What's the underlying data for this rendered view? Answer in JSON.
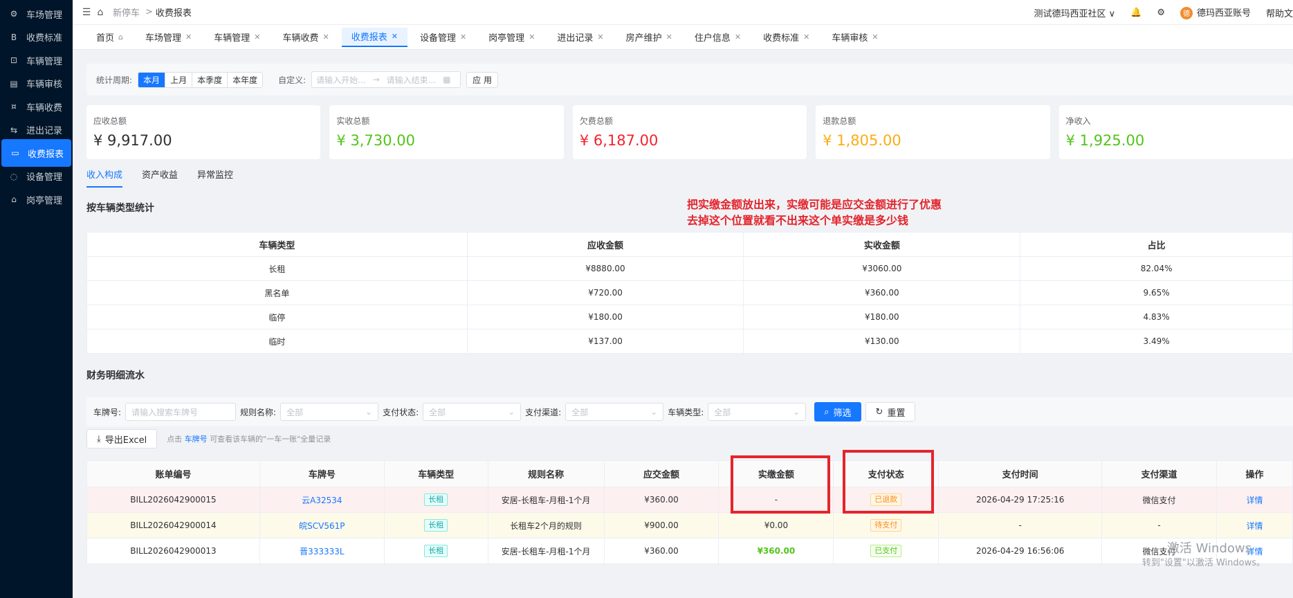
{
  "sidebar": {
    "items": [
      {
        "label": "车场管理",
        "icon": "gear-icon"
      },
      {
        "label": "收费标准",
        "icon": "b-icon"
      },
      {
        "label": "车辆管理",
        "icon": "car-icon"
      },
      {
        "label": "车辆审核",
        "icon": "audit-icon"
      },
      {
        "label": "车辆收费",
        "icon": "coin-icon"
      },
      {
        "label": "进出记录",
        "icon": "record-icon"
      },
      {
        "label": "收费报表",
        "icon": "report-icon"
      },
      {
        "label": "设备管理",
        "icon": "device-icon"
      },
      {
        "label": "岗亭管理",
        "icon": "booth-icon"
      }
    ]
  },
  "header": {
    "breadcrumb": [
      "新停车",
      "收费报表"
    ],
    "community": "测试德玛西亚社区",
    "account": "德玛西亚账号",
    "avatar_char": "德",
    "help": "帮助文"
  },
  "tabs": [
    "首页",
    "车场管理",
    "车辆管理",
    "车辆收费",
    "收费报表",
    "设备管理",
    "岗亭管理",
    "进出记录",
    "房产维护",
    "住户信息",
    "收费标准",
    "车辆审核"
  ],
  "period": {
    "label": "统计周期:",
    "options": [
      "本月",
      "上月",
      "本季度",
      "本年度"
    ],
    "custom_label": "自定义:",
    "start_placeholder": "请输入开始...",
    "end_placeholder": "请输入结束...",
    "apply": "应 用"
  },
  "cards": [
    {
      "title": "应收总额",
      "value": "¥ 9,917.00",
      "color": "#303133"
    },
    {
      "title": "实收总额",
      "value": "¥ 3,730.00",
      "color": "#52c41a"
    },
    {
      "title": "欠费总额",
      "value": "¥ 6,187.00",
      "color": "#f5222d"
    },
    {
      "title": "退款总额",
      "value": "¥ 1,805.00",
      "color": "#faad14"
    },
    {
      "title": "净收入",
      "value": "¥ 1,925.00",
      "color": "#52c41a"
    }
  ],
  "subtabs": [
    "收入构成",
    "资产收益",
    "异常监控"
  ],
  "type_stats": {
    "title": "按车辆类型统计",
    "headers": [
      "车辆类型",
      "应收金额",
      "实收金额",
      "占比"
    ],
    "rows": [
      [
        "长租",
        "¥8880.00",
        "¥3060.00",
        "82.04%"
      ],
      [
        "黑名单",
        "¥720.00",
        "¥360.00",
        "9.65%"
      ],
      [
        "临停",
        "¥180.00",
        "¥180.00",
        "4.83%"
      ],
      [
        "临时",
        "¥137.00",
        "¥130.00",
        "3.49%"
      ]
    ]
  },
  "annotation": {
    "line1": "把实缴金额放出来，实缴可能是应交金额进行了优惠",
    "line2": "去掉这个位置就看不出来这个单实缴是多少钱"
  },
  "detail": {
    "title": "财务明细流水",
    "filters": {
      "plate_label": "车牌号:",
      "plate_placeholder": "请输入搜索车牌号",
      "rule_label": "规则名称:",
      "pay_status_label": "支付状态:",
      "pay_channel_label": "支付渠道:",
      "car_type_label": "车辆类型:",
      "all": "全部",
      "filter_btn": "筛选",
      "reset_btn": "重置"
    },
    "export_btn": "导出Excel",
    "hint_prefix": "点击",
    "hint_link": "车牌号",
    "hint_suffix": "可查看该车辆的\"一车一账\"全量记录",
    "headers": [
      "账单编号",
      "车牌号",
      "车辆类型",
      "规则名称",
      "应交金额",
      "实缴金额",
      "支付状态",
      "支付时间",
      "支付渠道",
      "操作"
    ],
    "rows": [
      {
        "id": "BILL2026042900015",
        "plate": "云A32534",
        "type": "长租",
        "rule": "安居-长租车-月租-1个月",
        "due": "¥360.00",
        "paid": "-",
        "status": "已退款",
        "status_kind": "orange",
        "time": "2026-04-29 17:25:16",
        "channel": "微信支付",
        "op": "详情",
        "row": "pink"
      },
      {
        "id": "BILL2026042900014",
        "plate": "皖SCV561P",
        "type": "长租",
        "rule": "长租车2个月的规则",
        "due": "¥900.00",
        "paid": "¥0.00",
        "status": "待支付",
        "status_kind": "orange",
        "time": "-",
        "channel": "-",
        "op": "详情",
        "row": "yellow"
      },
      {
        "id": "BILL2026042900013",
        "plate": "晋333333L",
        "type": "长租",
        "rule": "安居-长租车-月租-1个月",
        "due": "¥360.00",
        "paid": "¥360.00",
        "status": "已支付",
        "status_kind": "green",
        "time": "2026-04-29 16:56:06",
        "channel": "微信支付",
        "op": "详情",
        "row": "white"
      }
    ]
  },
  "watermark": {
    "line1": "激活 Windows",
    "line2": "转到\"设置\"以激活 Windows。"
  }
}
